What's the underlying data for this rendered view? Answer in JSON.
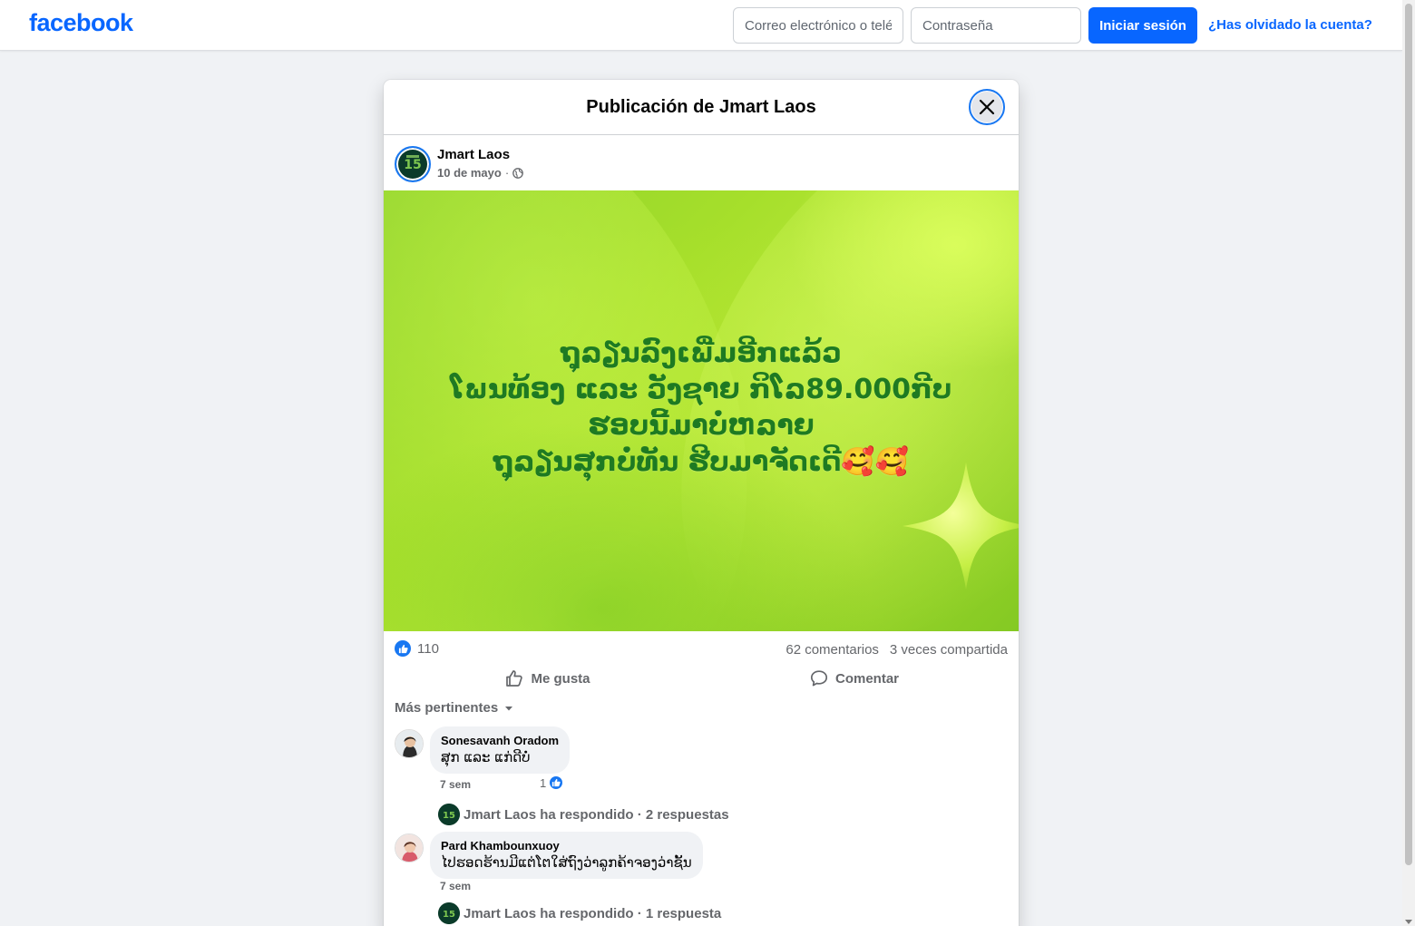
{
  "topbar": {
    "logo": "facebook",
    "email_placeholder": "Correo electrónico o teléfono",
    "password_placeholder": "Contraseña",
    "login_label": "Iniciar sesión",
    "forgot_label": "¿Has olvidado la cuenta?"
  },
  "dialog": {
    "title": "Publicación de Jmart Laos"
  },
  "post": {
    "author": "Jmart Laos",
    "date": "10 de mayo",
    "separator": "·",
    "image_text_lines": [
      "ຖຸລຽນລົງເພີ່ມອີກແລ້ວ",
      "ໂພນທ້ອງ ແລະ ວັງຊາຍ ກິໂລ89.000ກີບ",
      "ຮອບນີ້ມາບໍ່ຫລາຍ",
      "ຖຸລຽນສຸກບໍ່ທັນ ຮີບມາຈັດເດີ🥰🥰"
    ],
    "like_count": "110",
    "comments_count": "62 comentarios",
    "shares_count": "3 veces compartida",
    "like_label": "Me gusta",
    "comment_label": "Comentar",
    "sort_label": "Más pertinentes"
  },
  "comments": [
    {
      "author": "Sonesavanh Oradom",
      "text": "ສຸກ ແລະ ແກ່ດີບໍ່",
      "time": "7 sem",
      "reactions": "1",
      "reply_text": "Jmart Laos ha respondido · 2 respuestas"
    },
    {
      "author": "Pard Khambounxuoy",
      "text": "ໄປຮອດຮ້ານມີແຕ່ໂຕໃສ່ຖົງວ່າລູກຄ້າຈອງວ່າຊັ້ນ",
      "time": "7 sem",
      "reply_text": "Jmart Laos ha respondido · 1 respuesta"
    }
  ],
  "colors": {
    "brand": "#0866ff",
    "like_blue": "#1877f2",
    "image_text_green": "#1e7a22"
  }
}
